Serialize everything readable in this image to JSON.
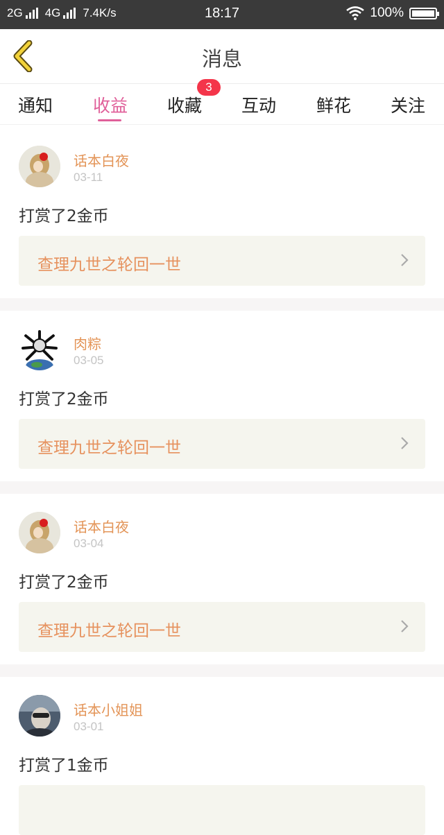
{
  "status_bar": {
    "network_2g": "2G",
    "network_4g": "4G",
    "speed": "7.4K/s",
    "time": "18:17",
    "battery": "100%",
    "battery_level": 1.0
  },
  "header": {
    "title": "消息",
    "back_icon": "chevron-left-icon"
  },
  "tabs": [
    {
      "label": "通知"
    },
    {
      "label": "收益",
      "active": true
    },
    {
      "label": "收藏",
      "badge": "3"
    },
    {
      "label": "互动"
    },
    {
      "label": "鲜花"
    },
    {
      "label": "关注"
    }
  ],
  "feed": [
    {
      "name": "话本白夜",
      "date": "03-11",
      "message": "打赏了2金币",
      "link": "查理九世之轮回一世"
    },
    {
      "name": "肉粽",
      "date": "03-05",
      "message": "打赏了2金币",
      "link": "查理九世之轮回一世"
    },
    {
      "name": "话本白夜",
      "date": "03-04",
      "message": "打赏了2金币",
      "link": "查理九世之轮回一世"
    },
    {
      "name": "话本小姐姐",
      "date": "03-01",
      "message": "打赏了1金币",
      "link": ""
    }
  ],
  "colors": {
    "accent": "#e0609a",
    "name": "#e39457",
    "badge": "#f4354a",
    "card_bg": "#f5f5ee"
  }
}
